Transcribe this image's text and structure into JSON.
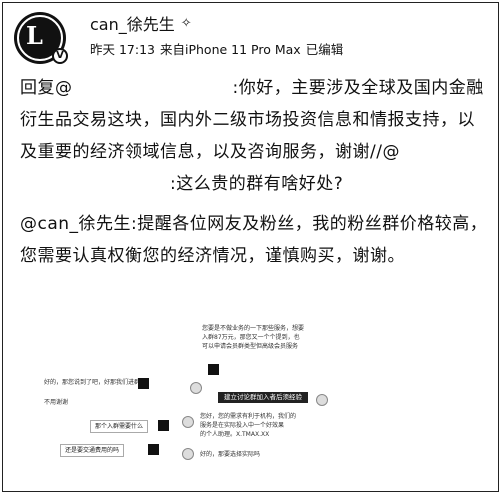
{
  "post": {
    "author": "can_徐先生",
    "author_badge": "sparkle-icon",
    "time": "昨天 17:13",
    "source": "来自iPhone 11 Pro Max",
    "edited": "已编辑",
    "reply_prefix": "回复@",
    "reply_body": ":你好，主要涉及全球及国内金融衍生品交易这块，国内外二级市场投资信息和情报支持，以及重要的经济领域信息，以及咨询服务，谢谢//@",
    "reply_suffix": ":这么贵的群有啥好处?",
    "notice_mention": "@can_徐先生",
    "notice_body": ":提醒各位网友及粉丝，我的粉丝群价格较高，您需要认真权衡您的经济情况，谨慎购买，谢谢。"
  },
  "embedded_chat": {
    "right_text": [
      "您要是不做业务的一下那些服务，想要",
      "入群87万元，那您又一个个提到，也",
      "可以申请会员群类型但高级会员服务"
    ],
    "right_pill": "建立讨论群加入者后须经验",
    "left_msgs": [
      "好的，那您说到了吧，好那我们进群",
      "不用谢谢",
      "那个入群需要什么",
      "还是要交通费用的吗"
    ],
    "left_a": "好的，那我选择什么",
    "right_small": [
      "您好，您的需求有利于机构，我们的",
      "服务是在实际投入中一个好效果",
      "的个人助理。X.TMAX.XX"
    ],
    "right_last": "好的，那要选择实际吗"
  }
}
